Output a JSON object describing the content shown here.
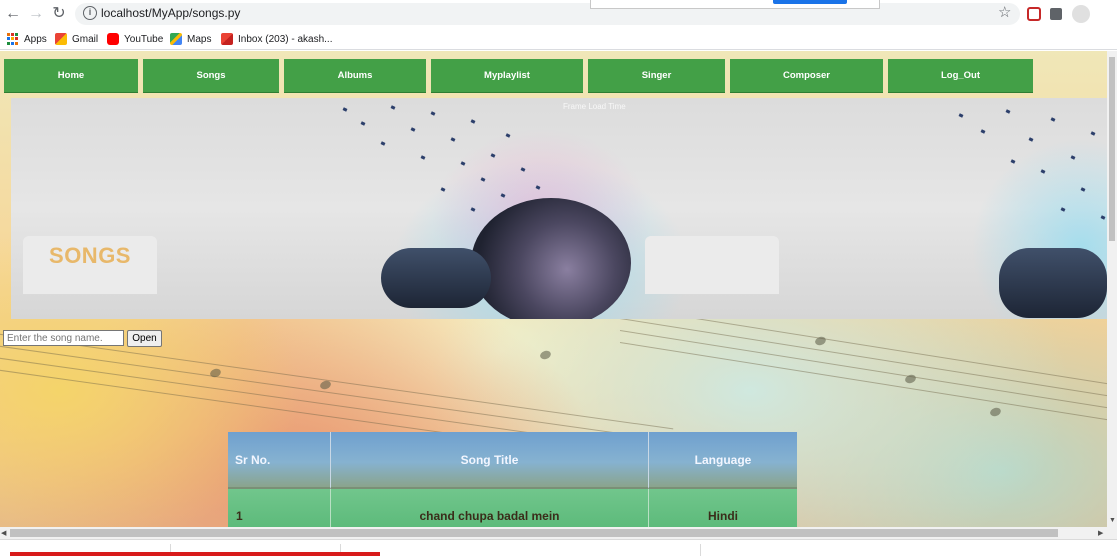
{
  "browser": {
    "url": "localhost/MyApp/songs.py",
    "bookmarks": [
      "Apps",
      "Gmail",
      "YouTube",
      "Maps",
      "Inbox (203) - akash..."
    ]
  },
  "nav": {
    "items": [
      "Home",
      "Songs",
      "Albums",
      "Myplaylist",
      "Singer",
      "Composer",
      "Log_Out"
    ]
  },
  "frame_label": "Frame Load Time",
  "page": {
    "title": "SONGS",
    "search_placeholder": "Enter the song name.",
    "open_label": "Open"
  },
  "table": {
    "headers": [
      "Sr No.",
      "Song Title",
      "Language"
    ],
    "rows": [
      [
        "1",
        "chand chupa badal mein",
        "Hindi"
      ]
    ]
  },
  "colors": {
    "nav_green": "#43a047",
    "title_gold": "#e8b86a",
    "header_blue": "#6fa0cf",
    "row_green": "#5cba7a"
  }
}
